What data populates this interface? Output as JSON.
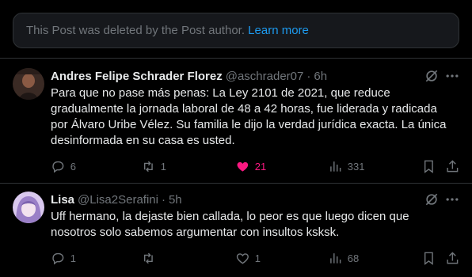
{
  "deleted_notice": {
    "text": "This Post was deleted by the Post author.",
    "link": "Learn more"
  },
  "posts": [
    {
      "name": "Andres Felipe Schrader Florez",
      "handle": "@aschrader07",
      "separator": "·",
      "time": "6h",
      "lines": [
        "Para que no pase más penas: La Ley 2101 de 2021, que reduce",
        "gradualmente la jornada laboral de 48 a 42 horas, fue liderada y radicada",
        "por Álvaro Uribe Vélez. Su familia le dijo la verdad jurídica exacta. La única",
        "desinformada en su casa es usted."
      ],
      "replies": "6",
      "reposts": "1",
      "likes": "21",
      "liked": true,
      "views": "331"
    },
    {
      "name": "Lisa",
      "handle": "@Lisa2Serafini",
      "separator": "·",
      "time": "5h",
      "lines": [
        "Uff hermano, la dejaste bien callada, lo peor es que luego dicen que",
        "nosotros solo sabemos argumentar con insultos ksksk."
      ],
      "replies": "1",
      "reposts": "",
      "likes": "1",
      "liked": false,
      "views": "68"
    }
  ],
  "colors": {
    "background": "#000000",
    "text": "#e7e9ea",
    "muted": "#71767b",
    "link": "#1d9bf0",
    "like": "#f91880",
    "border": "#2f3336"
  },
  "icons": [
    "reply-icon",
    "repost-icon",
    "like-icon",
    "views-icon",
    "bookmark-icon",
    "share-icon",
    "grok-icon",
    "more-icon"
  ]
}
